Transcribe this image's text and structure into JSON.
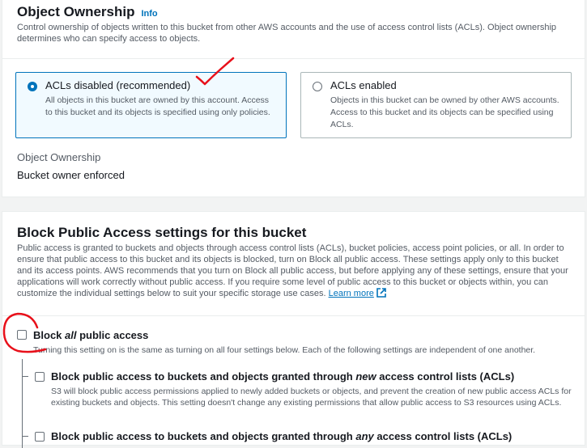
{
  "object_ownership": {
    "title": "Object Ownership",
    "info_link": "Info",
    "description": "Control ownership of objects written to this bucket from other AWS accounts and the use of access control lists (ACLs). Object ownership determines who can specify access to objects.",
    "options": [
      {
        "label": "ACLs disabled (recommended)",
        "description": "All objects in this bucket are owned by this account. Access to this bucket and its objects is specified using only policies.",
        "selected": true
      },
      {
        "label": "ACLs enabled",
        "description": "Objects in this bucket can be owned by other AWS accounts. Access to this bucket and its objects can be specified using ACLs.",
        "selected": false
      }
    ],
    "field_label": "Object Ownership",
    "field_value": "Bucket owner enforced"
  },
  "block_public_access": {
    "title": "Block Public Access settings for this bucket",
    "description": "Public access is granted to buckets and objects through access control lists (ACLs), bucket policies, access point policies, or all. In order to ensure that public access to this bucket and its objects is blocked, turn on Block all public access. These settings apply only to this bucket and its access points. AWS recommends that you turn on Block all public access, but before applying any of these settings, ensure that your applications will work correctly without public access. If you require some level of public access to this bucket or objects within, you can customize the individual settings below to suit your specific storage use cases.",
    "learn_more": "Learn more",
    "block_all": {
      "label_pre": "Block ",
      "label_em": "all",
      "label_post": " public access",
      "description": "Turning this setting on is the same as turning on all four settings below. Each of the following settings are independent of one another.",
      "checked": false
    },
    "settings": [
      {
        "label_pre": "Block public access to buckets and objects granted through ",
        "label_em": "new",
        "label_post": " access control lists (ACLs)",
        "description": "S3 will block public access permissions applied to newly added buckets or objects, and prevent the creation of new public access ACLs for existing buckets and objects. This setting doesn't change any existing permissions that allow public access to S3 resources using ACLs.",
        "checked": false
      },
      {
        "label_pre": "Block public access to buckets and objects granted through ",
        "label_em": "any",
        "label_post": " access control lists (ACLs)",
        "checked": false
      }
    ]
  },
  "colors": {
    "accent": "#0073bb",
    "annotation": "#e8101a"
  }
}
